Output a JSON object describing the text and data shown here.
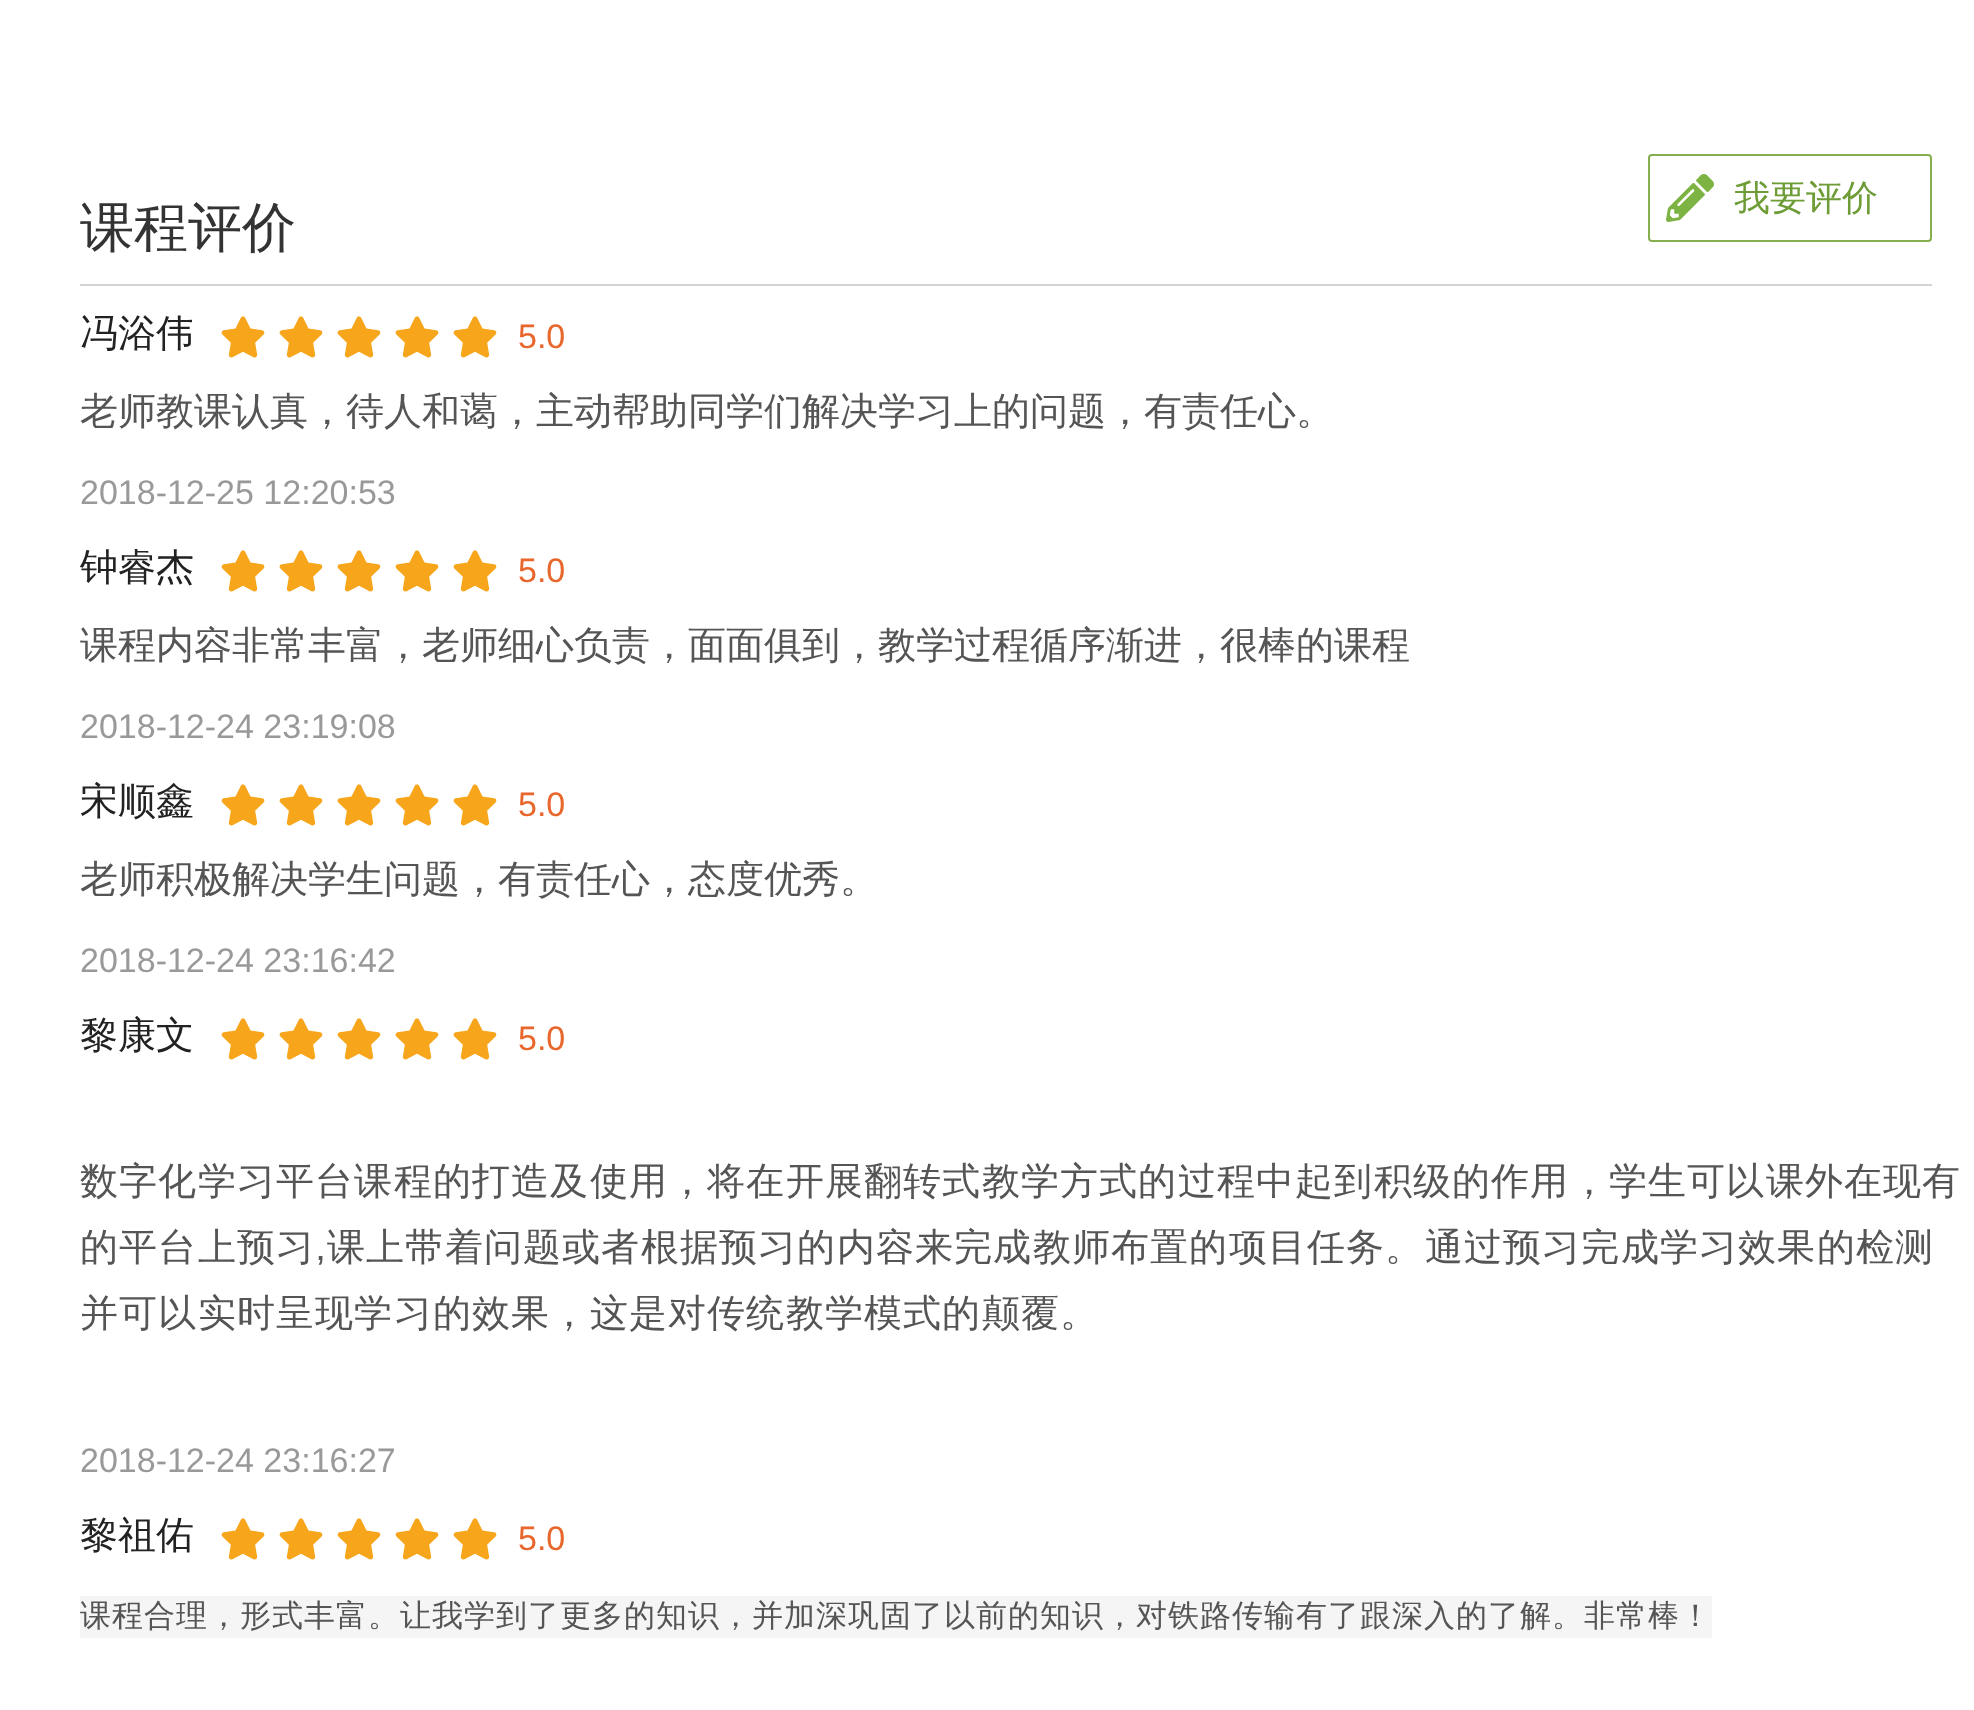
{
  "section": {
    "title": "课程评价",
    "action_button": {
      "label": "我要评价"
    }
  },
  "reviews": [
    {
      "kind": "plain",
      "name": "冯浴伟",
      "stars": 5,
      "score": "5.0",
      "comment": "老师教课认真，待人和蔼，主动帮助同学们解决学习上的问题，有责任心。",
      "time": "2018-12-25 12:20:53"
    },
    {
      "kind": "plain",
      "name": "钟睿杰",
      "stars": 5,
      "score": "5.0",
      "comment": "课程内容非常丰富，老师细心负责，面面俱到，教学过程循序渐进，很棒的课程",
      "time": "2018-12-24 23:19:08"
    },
    {
      "kind": "plain",
      "name": "宋顺鑫",
      "stars": 5,
      "score": "5.0",
      "comment": "老师积极解决学生问题，有责任心，态度优秀。",
      "time": "2018-12-24 23:16:42"
    },
    {
      "kind": "spaced",
      "name": "黎康文",
      "stars": 5,
      "score": "5.0",
      "comment": "数字化学习平台课程的打造及使用，将在开展翻转式教学方式的过程中起到积级的作用，学生可以课外在现有的平台上预习,课上带着问题或者根据预习的内容来完成教师布置的项目任务。通过预习完成学习效果的检测并可以实时呈现学习的效果，这是对传统教学模式的颠覆。",
      "time": "2018-12-24 23:16:27"
    },
    {
      "kind": "shaded",
      "name": "黎祖佑",
      "stars": 5,
      "score": "5.0",
      "comment": "课程合理，形式丰富。让我学到了更多的知识，并加深巩固了以前的知识，对铁路传输有了跟深入的了解。非常棒！"
    }
  ]
}
